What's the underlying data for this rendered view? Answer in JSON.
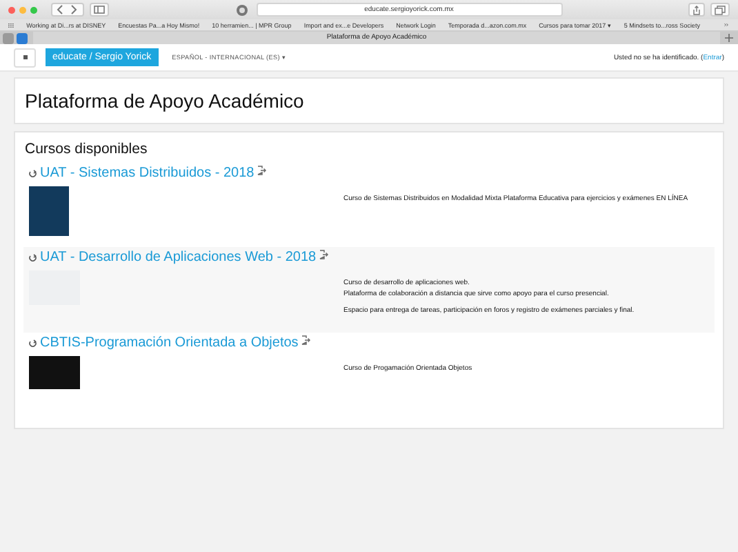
{
  "browser": {
    "url": "educate.sergioyorick.com.mx",
    "bookmarks": [
      "Working at Di...rs at DISNEY",
      "Encuestas Pa...a Hoy Mismo!",
      "10 herramien... | MPR Group",
      "Import and ex...e Developers",
      "Network Login",
      "Temporada d...azon.com.mx",
      "Cursos para tomar 2017 ▾",
      "5 Mindsets to...ross Society"
    ],
    "tab_title": "Plataforma de Apoyo Académico"
  },
  "navbar": {
    "brand": "educate / Sergio Yorick",
    "language": "ESPAÑOL - INTERNACIONAL (ES) ▾",
    "login_text": "Usted no se ha identificado. (",
    "login_link": "Entrar",
    "login_suffix": ")"
  },
  "page_title": "Plataforma de Apoyo Académico",
  "section_title": "Cursos disponibles",
  "courses": [
    {
      "title": "UAT - Sistemas Distribuidos - 2018",
      "description": [
        "Curso de Sistemas Distribuidos en Modalidad Mixta Plataforma Educativa para ejercicios y exámenes EN LÍNEA"
      ]
    },
    {
      "title": "UAT - Desarrollo de Aplicaciones Web - 2018",
      "description": [
        "Curso de desarrollo de aplicaciones web.\nPlataforma de colaboración a distancia que sirve como apoyo para el curso presencial.",
        "Espacio para entrega de tareas, participación en foros y registro de exámenes parciales y final."
      ]
    },
    {
      "title": "CBTIS-Programación Orientada a Objetos",
      "description": [
        "Curso de Progamación Orientada Objetos"
      ]
    }
  ]
}
